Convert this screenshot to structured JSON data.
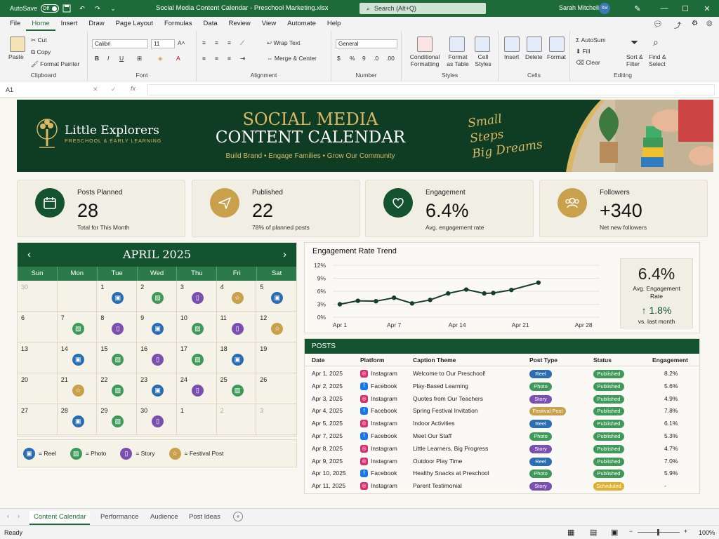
{
  "titlebar": {
    "autosave": "AutoSave",
    "toggle": "Off",
    "doc_title": "Social Media Content Calendar - Preschool Marketing.xlsx",
    "search": "Search (Alt+Q)",
    "user": "Sarah Mitchell",
    "avatar": "SM"
  },
  "menu": [
    "File",
    "Home",
    "Insert",
    "Draw",
    "Page Layout",
    "Formulas",
    "Data",
    "Review",
    "View",
    "Automate",
    "Help"
  ],
  "ribbon": {
    "clipboard": {
      "label": "Clipboard",
      "paste": "Paste",
      "cut": "Cut",
      "copy": "Copy",
      "format_painter": "Format Painter"
    },
    "font": {
      "label": "Font",
      "name": "Calibri",
      "size": "11"
    },
    "alignment": {
      "label": "Alignment",
      "wrap": "Wrap Text",
      "merge": "Merge & Center"
    },
    "number": {
      "label": "Number",
      "format": "General"
    },
    "styles": {
      "label": "Styles",
      "conditional": "Conditional Formatting",
      "format_table": "Format as Table",
      "cell_styles": "Cell Styles"
    },
    "cells": {
      "label": "Cells",
      "insert": "Insert",
      "delete": "Delete",
      "format": "Format"
    },
    "editing": {
      "label": "Editing",
      "autosum": "AutoSum",
      "fill": "Fill",
      "clear": "Clear",
      "sort": "Sort & Filter",
      "find": "Find & Select"
    }
  },
  "formula": {
    "namebox": "A1"
  },
  "banner": {
    "logo_name": "Little Explorers",
    "logo_sub": "PRESCHOOL & EARLY LEARNING",
    "title1": "SOCIAL MEDIA",
    "title2": "CONTENT CALENDAR",
    "subtitle": "Build Brand  •  Engage Families  •  Grow Our Community",
    "script": [
      "Small",
      "Steps",
      "Big Dreams"
    ]
  },
  "kpis": [
    {
      "label": "Posts Planned",
      "value": "28",
      "sub": "Total for This Month",
      "color": "#14532f",
      "icon": "calendar-icon"
    },
    {
      "label": "Published",
      "value": "22",
      "sub": "78% of planned posts",
      "color": "#c9a04c",
      "icon": "send-icon"
    },
    {
      "label": "Engagement",
      "value": "6.4%",
      "sub": "Avg. engagement rate",
      "color": "#14532f",
      "icon": "heart-icon"
    },
    {
      "label": "Followers",
      "value": "+340",
      "sub": "Net new followers",
      "color": "#c9a04c",
      "icon": "users-icon"
    }
  ],
  "calendar": {
    "month": "APRIL 2025",
    "days": [
      "Sun",
      "Mon",
      "Tue",
      "Wed",
      "Thu",
      "Fri",
      "Sat"
    ],
    "cells": [
      {
        "d": "30",
        "muted": true,
        "t": ""
      },
      {
        "d": "",
        "t": ""
      },
      {
        "d": "1",
        "t": "reel"
      },
      {
        "d": "2",
        "t": "photo"
      },
      {
        "d": "3",
        "t": "story"
      },
      {
        "d": "4",
        "t": "festival"
      },
      {
        "d": "5",
        "t": "reel"
      },
      {
        "d": "6",
        "t": ""
      },
      {
        "d": "7",
        "t": "photo"
      },
      {
        "d": "8",
        "t": "story"
      },
      {
        "d": "9",
        "t": "reel"
      },
      {
        "d": "10",
        "t": "photo"
      },
      {
        "d": "11",
        "t": "story"
      },
      {
        "d": "12",
        "t": "festival"
      },
      {
        "d": "13",
        "t": ""
      },
      {
        "d": "14",
        "t": "reel"
      },
      {
        "d": "15",
        "t": "photo"
      },
      {
        "d": "16",
        "t": "story"
      },
      {
        "d": "17",
        "t": "photo"
      },
      {
        "d": "18",
        "t": "reel"
      },
      {
        "d": "19",
        "t": ""
      },
      {
        "d": "20",
        "t": ""
      },
      {
        "d": "21",
        "t": "festival"
      },
      {
        "d": "22",
        "t": "photo"
      },
      {
        "d": "23",
        "t": "reel"
      },
      {
        "d": "24",
        "t": "story"
      },
      {
        "d": "25",
        "t": "photo"
      },
      {
        "d": "26",
        "t": ""
      },
      {
        "d": "27",
        "t": ""
      },
      {
        "d": "28",
        "t": "reel"
      },
      {
        "d": "29",
        "t": "photo"
      },
      {
        "d": "30",
        "t": "story"
      },
      {
        "d": "1",
        "muted": false,
        "t": ""
      },
      {
        "d": "2",
        "muted": true,
        "t": ""
      },
      {
        "d": "3",
        "muted": true,
        "t": ""
      }
    ],
    "legend": [
      {
        "type": "reel",
        "label": "= Reel"
      },
      {
        "type": "photo",
        "label": "= Photo"
      },
      {
        "type": "story",
        "label": "= Story"
      },
      {
        "type": "festival",
        "label": "= Festival Post"
      }
    ],
    "type_colors": {
      "reel": "#2a6db3",
      "photo": "#3f9a5a",
      "story": "#7b4fb0",
      "festival": "#c9a04c"
    }
  },
  "trend": {
    "title": "Engagement Rate Trend",
    "stat_value": "6.4%",
    "stat_label": "Avg. Engagement Rate",
    "delta": "↑ 1.8%",
    "delta_label": "vs. last month"
  },
  "chart_data": {
    "type": "line",
    "title": "Engagement Rate Trend",
    "x_ticks": [
      "Apr 1",
      "Apr 7",
      "Apr 14",
      "Apr 21",
      "Apr 28"
    ],
    "y_ticks": [
      "0%",
      "3%",
      "6%",
      "9%",
      "12%"
    ],
    "ylim": [
      0,
      12
    ],
    "x": [
      1,
      3,
      5,
      7,
      9,
      11,
      13,
      15,
      17,
      18,
      20,
      23
    ],
    "values": [
      3.0,
      3.8,
      3.7,
      4.5,
      3.2,
      4.0,
      5.5,
      6.4,
      5.5,
      5.6,
      6.3,
      8.0
    ],
    "grid": true
  },
  "posts": {
    "title": "POSTS",
    "columns": [
      "Date",
      "Platform",
      "Caption Theme",
      "Post Type",
      "Status",
      "Engagement"
    ],
    "rows": [
      {
        "date": "Apr 1, 2025",
        "platform": "Instagram",
        "theme": "Welcome to Our Preschool!",
        "type": "Reel",
        "status": "Published",
        "eng": "8.2%"
      },
      {
        "date": "Apr 2, 2025",
        "platform": "Facebook",
        "theme": "Play-Based Learning",
        "type": "Photo",
        "status": "Published",
        "eng": "5.6%"
      },
      {
        "date": "Apr 3, 2025",
        "platform": "Instagram",
        "theme": "Quotes from Our Teachers",
        "type": "Story",
        "status": "Published",
        "eng": "4.9%"
      },
      {
        "date": "Apr 4, 2025",
        "platform": "Facebook",
        "theme": "Spring Festival Invitation",
        "type": "Festival Post",
        "status": "Published",
        "eng": "7.8%"
      },
      {
        "date": "Apr 5, 2025",
        "platform": "Instagram",
        "theme": "Indoor Activities",
        "type": "Reel",
        "status": "Published",
        "eng": "6.1%"
      },
      {
        "date": "Apr 7, 2025",
        "platform": "Facebook",
        "theme": "Meet Our Staff",
        "type": "Photo",
        "status": "Published",
        "eng": "5.3%"
      },
      {
        "date": "Apr 8, 2025",
        "platform": "Instagram",
        "theme": "Little Learners, Big Progress",
        "type": "Story",
        "status": "Published",
        "eng": "4.7%"
      },
      {
        "date": "Apr 9, 2025",
        "platform": "Instagram",
        "theme": "Outdoor Play Time",
        "type": "Reel",
        "status": "Published",
        "eng": "7.0%"
      },
      {
        "date": "Apr 10, 2025",
        "platform": "Facebook",
        "theme": "Healthy Snacks at Preschool",
        "type": "Photo",
        "status": "Published",
        "eng": "5.9%"
      },
      {
        "date": "Apr 11, 2025",
        "platform": "Instagram",
        "theme": "Parent Testimonial",
        "type": "Story",
        "status": "Scheduled",
        "eng": "-"
      }
    ]
  },
  "tabs": [
    "Content Calendar",
    "Performance",
    "Audience",
    "Post Ideas"
  ],
  "status": {
    "ready": "Ready",
    "zoom": "100%"
  }
}
